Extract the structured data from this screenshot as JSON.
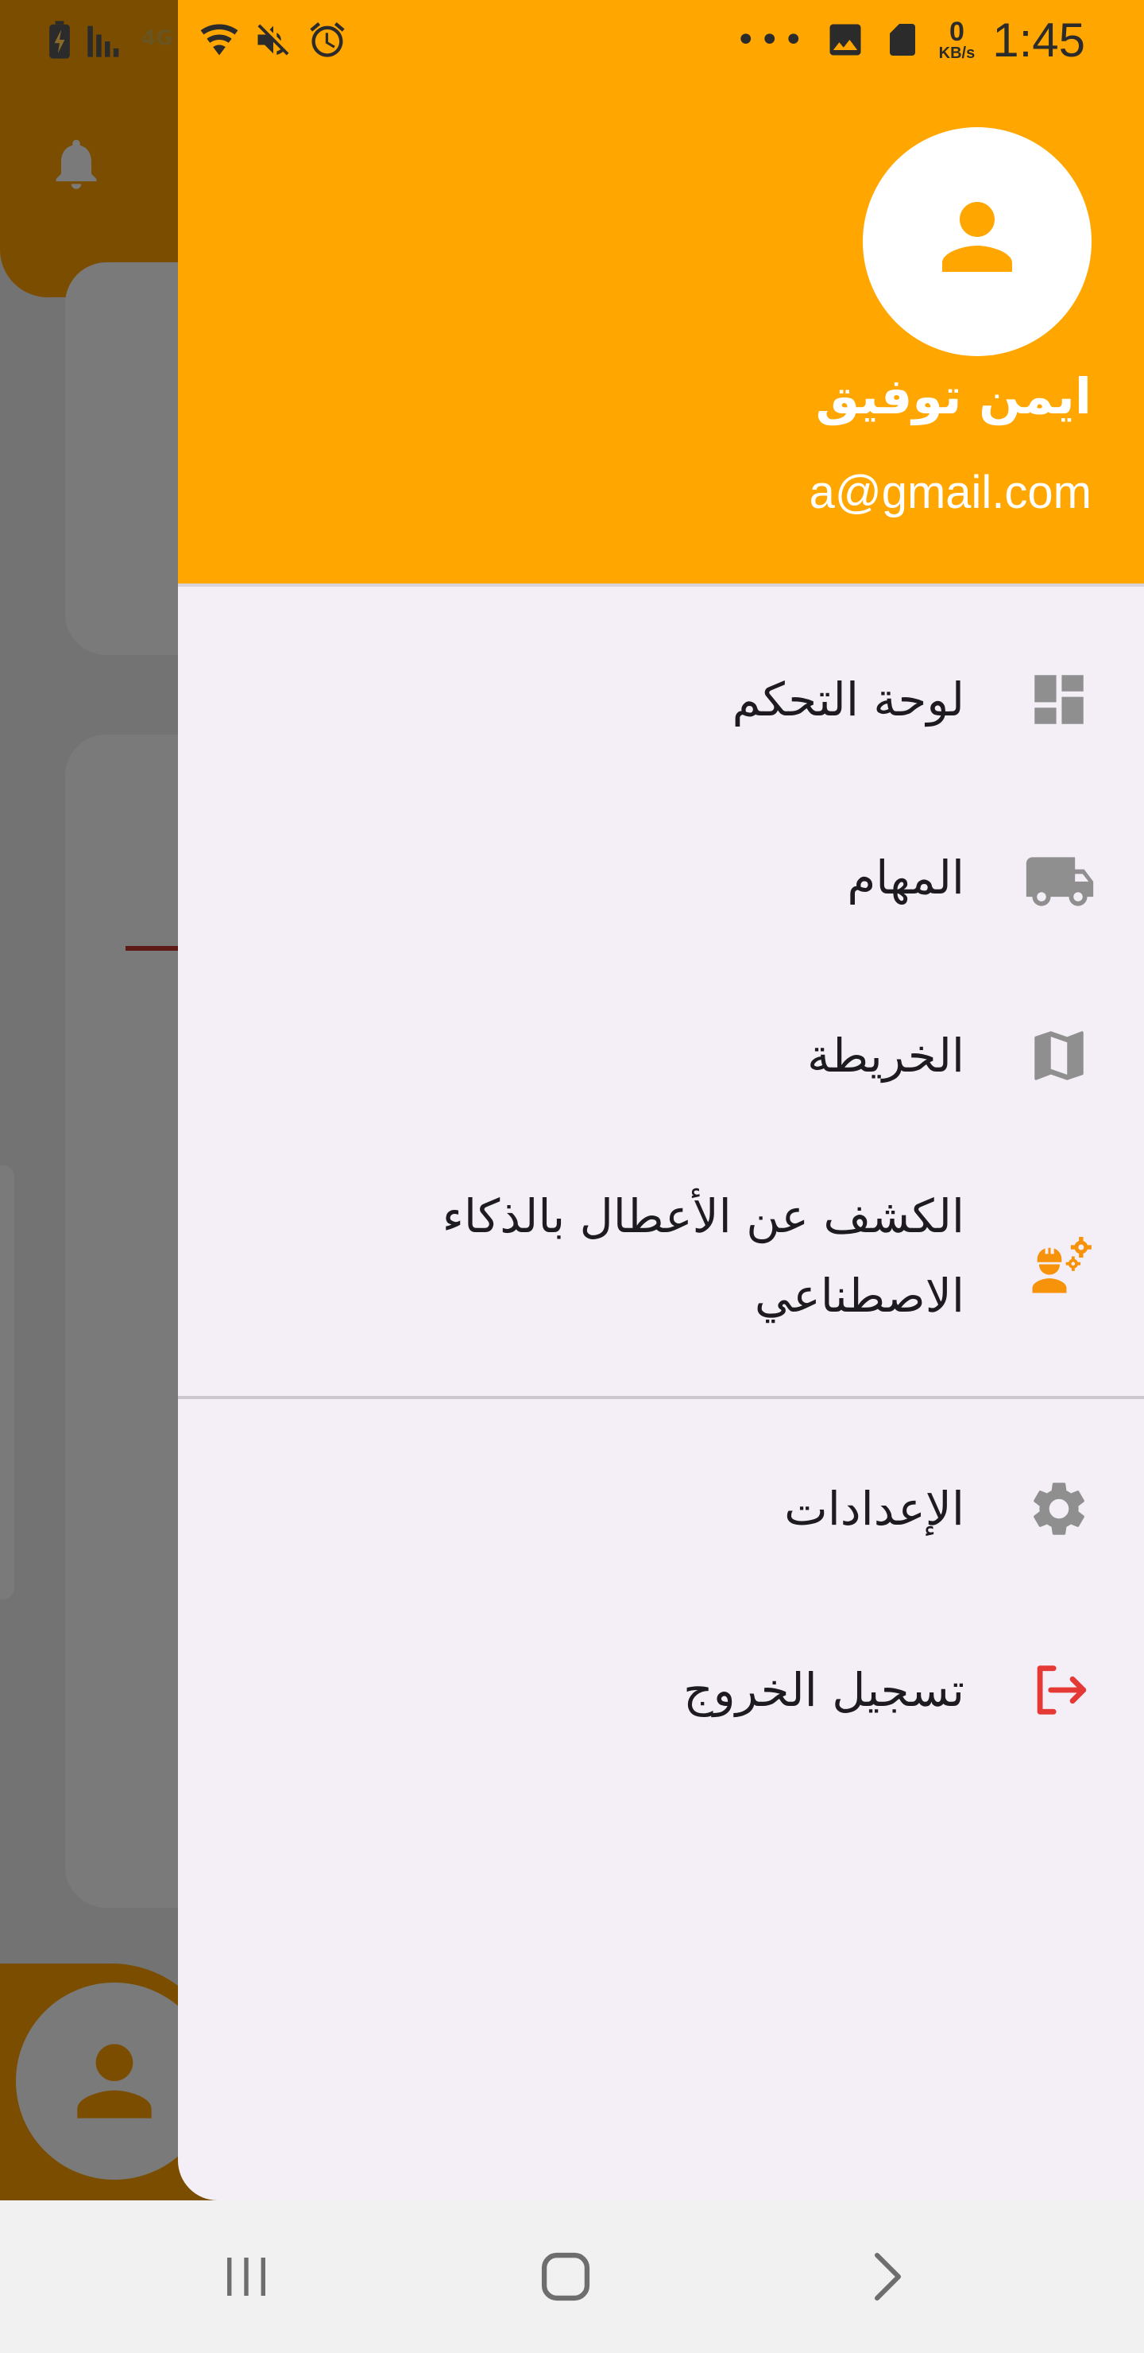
{
  "status_bar": {
    "time": "1:45",
    "network_speed_value": "0",
    "network_speed_unit": "KB/s",
    "more_indicator": "•••"
  },
  "drawer": {
    "header": {
      "user_name": "ايمن توفيق",
      "user_email": "a@gmail.com"
    },
    "menu_items": [
      {
        "label": "لوحة التحكم",
        "icon": "dashboard-icon"
      },
      {
        "label": "المهام",
        "icon": "truck-icon"
      },
      {
        "label": "الخريطة",
        "icon": "map-icon"
      },
      {
        "label": "الكشف عن الأعطال بالذكاء الاصطناعي",
        "icon": "engineer-gears-icon"
      }
    ],
    "secondary_items": [
      {
        "label": "الإعدادات",
        "icon": "gear-icon"
      },
      {
        "label": "تسجيل الخروج",
        "icon": "logout-icon"
      }
    ]
  },
  "colors": {
    "accent": "#ffa600",
    "logout": "#e53935",
    "icon_grey": "#8f8f8f",
    "ai_icon": "#f7930a"
  }
}
